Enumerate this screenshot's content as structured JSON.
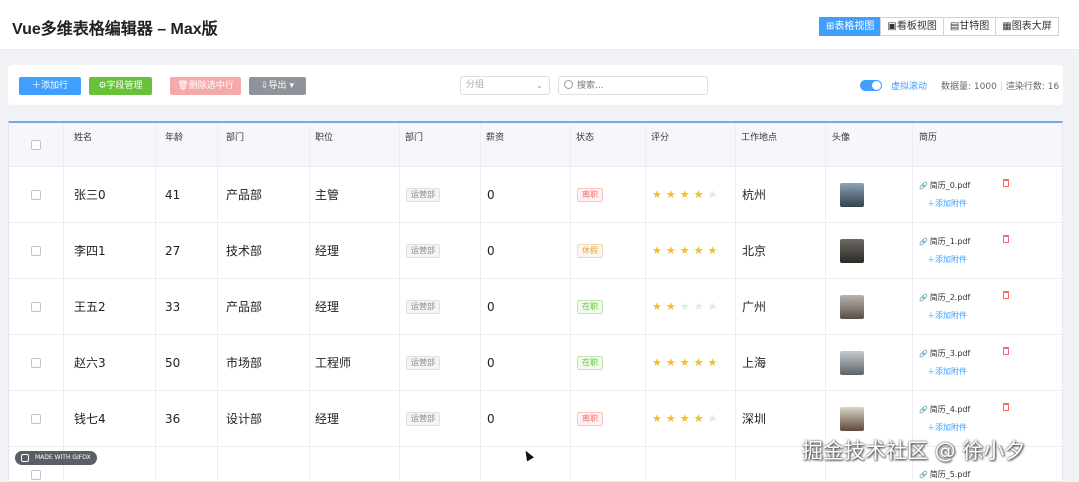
{
  "app": {
    "title": "Vue多维表格编辑器 – Max版"
  },
  "view_tabs": [
    {
      "icon": "grid-icon",
      "label": "⊞表格视图",
      "active": true
    },
    {
      "icon": "kanban-icon",
      "label": "▣看板视图",
      "active": false
    },
    {
      "icon": "gantt-icon",
      "label": "▤甘特图",
      "active": false
    },
    {
      "icon": "dashboard-icon",
      "label": "▦图表大屏",
      "active": false
    }
  ],
  "toolbar": {
    "add_row": "＋添加行",
    "field_manage": "⚙字段管理",
    "delete_selected": "🗑删除选中行",
    "export": "⇩导出",
    "group_placeholder": "分组",
    "search_placeholder": "搜索...",
    "virtual_scroll_label": "虚拟滚动",
    "data_count": "数据量: 1000",
    "render_count": "渲染行数: 16"
  },
  "columns": [
    "姓名",
    "年龄",
    "部门",
    "职位",
    "部门",
    "薪资",
    "状态",
    "评分",
    "工作地点",
    "头像",
    "简历"
  ],
  "rows": [
    {
      "name": "张三0",
      "age": "41",
      "dept": "产品部",
      "position": "主管",
      "dept_tag": "运营部",
      "salary": "0",
      "status": "离职",
      "status_color": "#f56c6c",
      "rating": 4,
      "city": "杭州",
      "avatar_colors": [
        "#8aa3b8",
        "#35414d"
      ],
      "resume": "简历_0.pdf",
      "add_attachment": "＋添加附件"
    },
    {
      "name": "李四1",
      "age": "27",
      "dept": "技术部",
      "position": "经理",
      "dept_tag": "运营部",
      "salary": "0",
      "status": "休假",
      "status_color": "#e6a23c",
      "rating": 5,
      "city": "北京",
      "avatar_colors": [
        "#6d6a64",
        "#2c2a26"
      ],
      "resume": "简历_1.pdf",
      "add_attachment": "＋添加附件"
    },
    {
      "name": "王五2",
      "age": "33",
      "dept": "产品部",
      "position": "经理",
      "dept_tag": "运营部",
      "salary": "0",
      "status": "在职",
      "status_color": "#67c23a",
      "rating": 2,
      "city": "广州",
      "avatar_colors": [
        "#b9b5ad",
        "#575049"
      ],
      "resume": "简历_2.pdf",
      "add_attachment": "＋添加附件"
    },
    {
      "name": "赵六3",
      "age": "50",
      "dept": "市场部",
      "position": "工程师",
      "dept_tag": "运营部",
      "salary": "0",
      "status": "在职",
      "status_color": "#67c23a",
      "rating": 5,
      "city": "上海",
      "avatar_colors": [
        "#c4c9cc",
        "#5d6468"
      ],
      "resume": "简历_3.pdf",
      "add_attachment": "＋添加附件"
    },
    {
      "name": "钱七4",
      "age": "36",
      "dept": "设计部",
      "position": "经理",
      "dept_tag": "运营部",
      "salary": "0",
      "status": "离职",
      "status_color": "#f56c6c",
      "rating": 4,
      "city": "深圳",
      "avatar_colors": [
        "#d9d3c8",
        "#5e4a3a"
      ],
      "resume": "简历_4.pdf",
      "add_attachment": "＋添加附件"
    },
    {
      "name": "",
      "age": "",
      "dept": "",
      "position": "",
      "dept_tag": "",
      "salary": "",
      "status": "",
      "status_color": "#dddddd",
      "rating": 0,
      "city": "",
      "avatar_colors": [
        "#ffffff",
        "#ffffff"
      ],
      "resume": "简历_5.pdf",
      "add_attachment": ""
    }
  ],
  "overlay": {
    "watermark": "掘金技术社区 @ 徐小夕",
    "gifox_badge": "MADE WITH GIFOX"
  },
  "colors": {
    "primary": "#409eff",
    "success": "#67c23a",
    "danger": "#f56c6c",
    "warning": "#e6a23c",
    "star": "#f7ba2a"
  }
}
